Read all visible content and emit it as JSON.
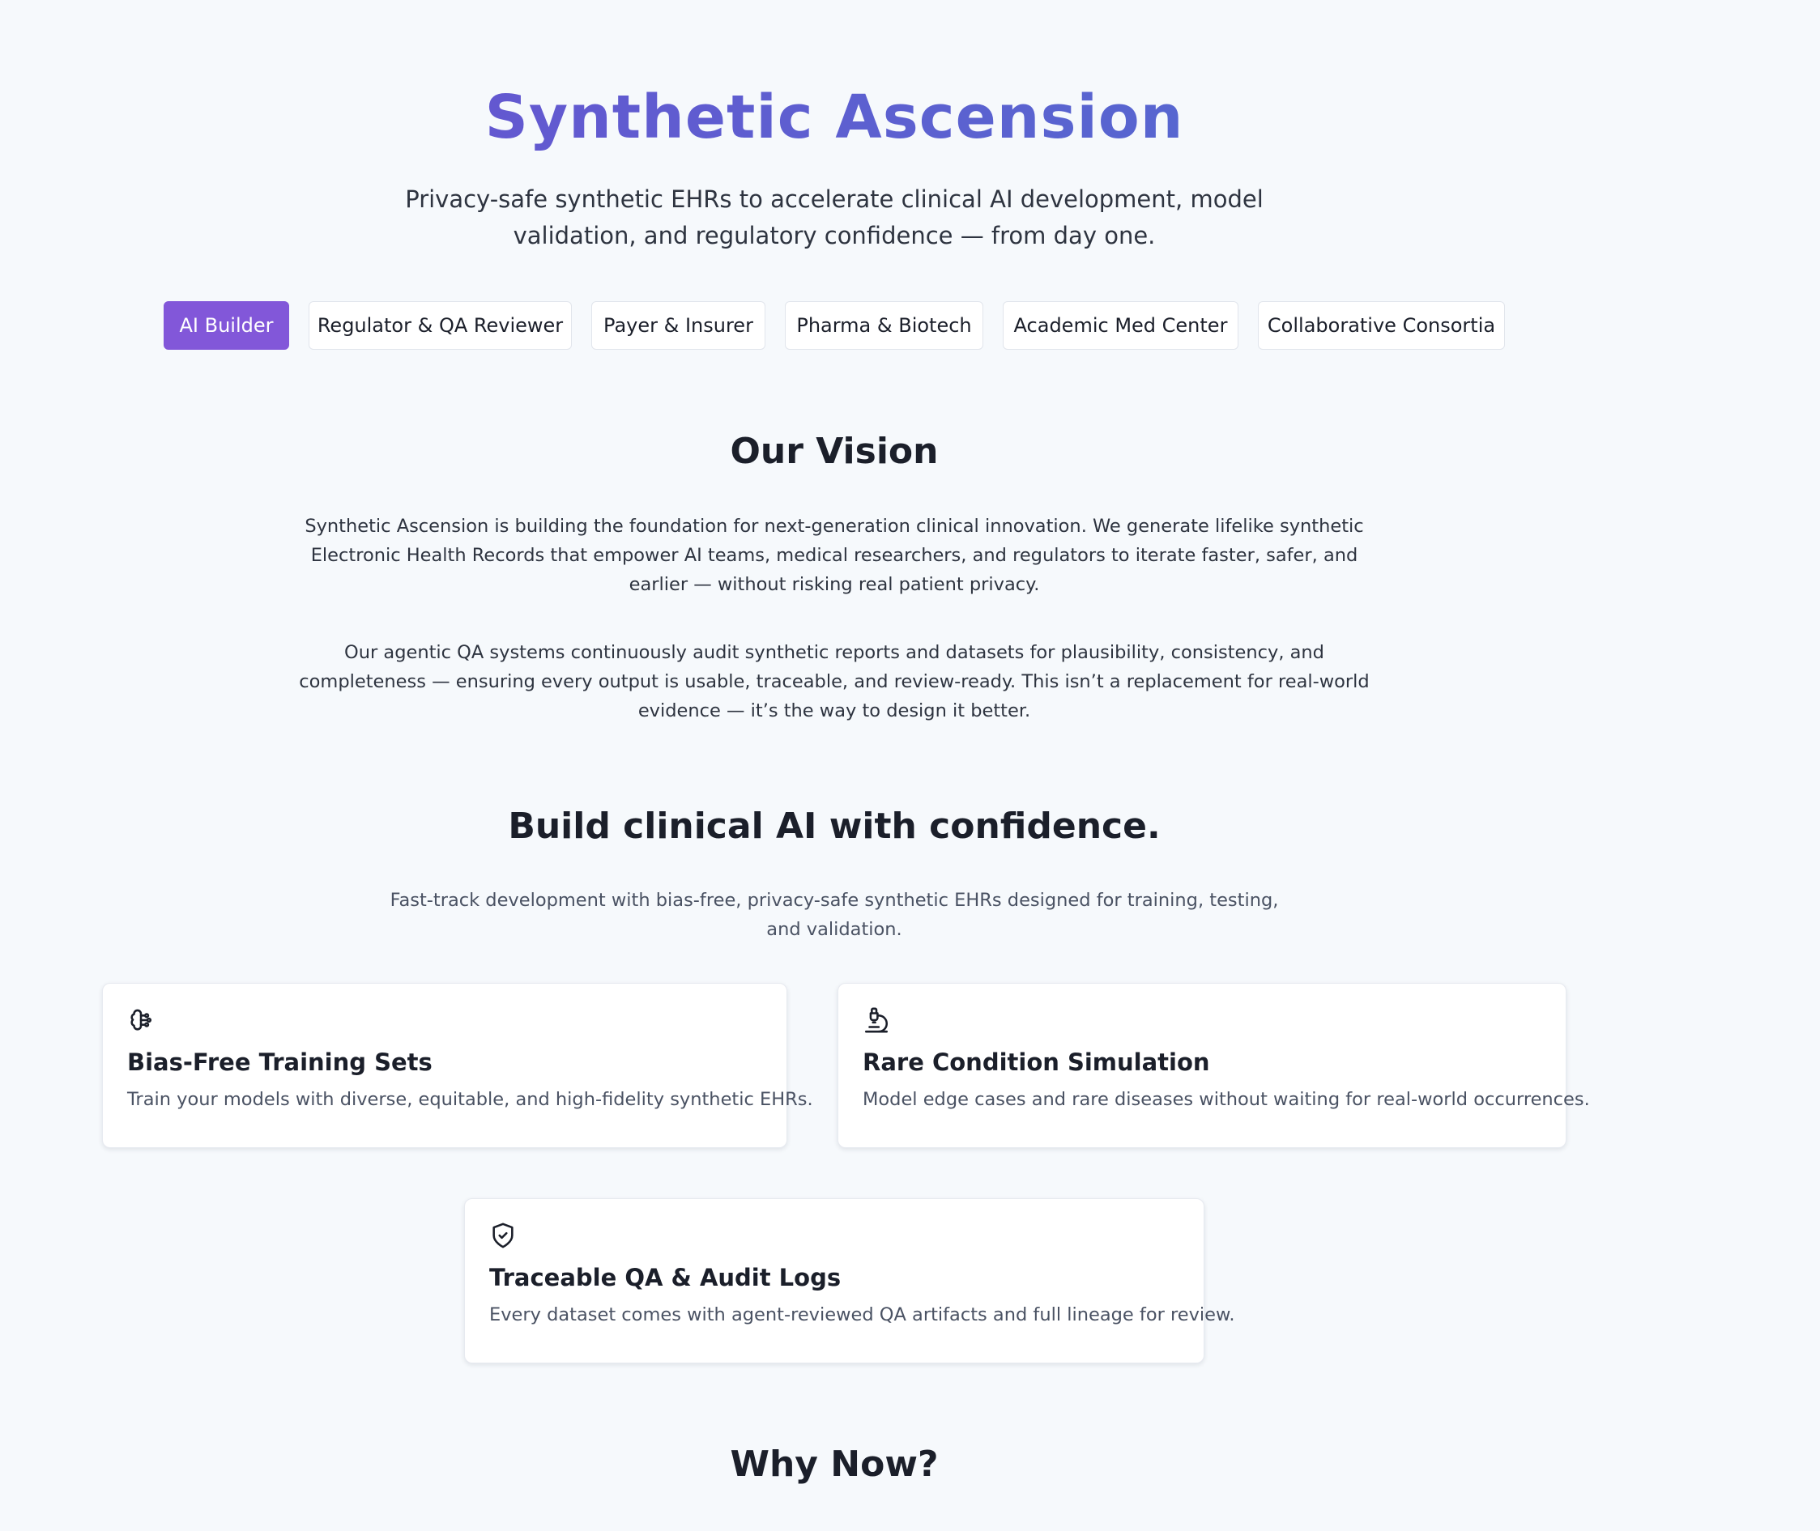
{
  "hero": {
    "title": "Synthetic Ascension",
    "subtitle": "Privacy-safe synthetic EHRs to accelerate clinical AI development, model validation, and regulatory confidence — from day one."
  },
  "tabs": [
    {
      "label": "AI Builder",
      "active": true
    },
    {
      "label": "Regulator & QA Reviewer",
      "active": false
    },
    {
      "label": "Payer & Insurer",
      "active": false
    },
    {
      "label": "Pharma & Biotech",
      "active": false
    },
    {
      "label": "Academic Med Center",
      "active": false
    },
    {
      "label": "Collaborative Consortia",
      "active": false
    }
  ],
  "vision": {
    "heading": "Our Vision",
    "paragraph1": "Synthetic Ascension is building the foundation for next-generation clinical innovation. We generate lifelike synthetic Electronic Health Records that empower AI teams, medical researchers, and regulators to iterate faster, safer, and earlier — without risking real patient privacy.",
    "paragraph2": "Our agentic QA systems continuously audit synthetic reports and datasets for plausibility, consistency, and completeness — ensuring every output is usable, traceable, and review-ready. This isn’t a replacement for real-world evidence — it’s the way to design it better."
  },
  "audience": {
    "heading": "Build clinical AI with confidence.",
    "lead": "Fast-track development with bias-free, privacy-safe synthetic EHRs designed for training, testing, and validation.",
    "cards": [
      {
        "icon": "brain-icon",
        "title": "Bias-Free Training Sets",
        "text": "Train your models with diverse, equitable, and high-fidelity synthetic EHRs."
      },
      {
        "icon": "microscope-icon",
        "title": "Rare Condition Simulation",
        "text": "Model edge cases and rare diseases without waiting for real-world occurrences."
      },
      {
        "icon": "shield-check-icon",
        "title": "Traceable QA & Audit Logs",
        "text": "Every dataset comes with agent-reviewed QA artifacts and full lineage for review."
      }
    ]
  },
  "why_now": {
    "heading": "Why Now?"
  },
  "colors": {
    "accent": "#8257d9",
    "title_gradient_start": "#6b4fd0",
    "title_gradient_end": "#4f6fd0",
    "background": "#f6f9fc"
  }
}
